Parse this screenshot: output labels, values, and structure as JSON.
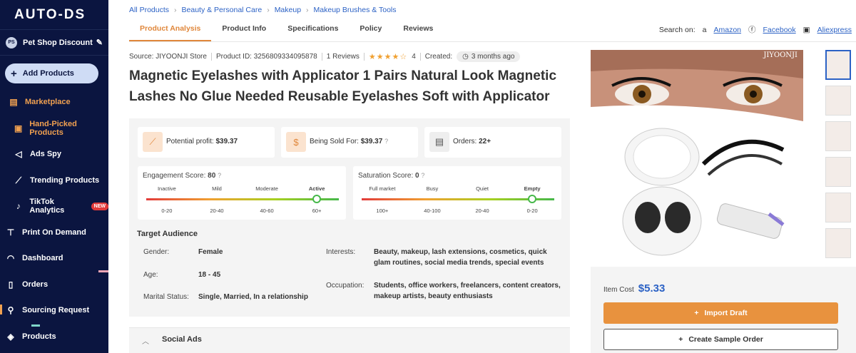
{
  "sidebar": {
    "logo": "AUTO-DS",
    "store_badge": "PS",
    "store_name": "Pet Shop Discount",
    "add_products": "Add Products",
    "items": [
      {
        "label": "Marketplace",
        "icon": "store-icon"
      },
      {
        "label": "Hand-Picked Products",
        "icon": "box-icon"
      },
      {
        "label": "Ads Spy",
        "icon": "megaphone-icon"
      },
      {
        "label": "Trending Products",
        "icon": "trend-icon"
      },
      {
        "label": "TikTok Analytics",
        "icon": "tiktok-icon",
        "badge": "NEW"
      },
      {
        "label": "Print On Demand",
        "icon": "shirt-icon"
      },
      {
        "label": "Dashboard",
        "icon": "gauge-icon"
      },
      {
        "label": "Orders",
        "icon": "clipboard-icon"
      },
      {
        "label": "Sourcing Request",
        "icon": "sourcing-icon"
      },
      {
        "label": "Products",
        "icon": "cube-icon"
      }
    ]
  },
  "breadcrumbs": [
    "All Products",
    "Beauty & Personal Care",
    "Makeup",
    "Makeup Brushes & Tools"
  ],
  "tabs": [
    "Product Analysis",
    "Product Info",
    "Specifications",
    "Policy",
    "Reviews"
  ],
  "search_on": {
    "label": "Search on:",
    "links": [
      "Amazon",
      "Facebook",
      "Aliexpress"
    ]
  },
  "meta": {
    "source": "Source: JIYOONJI Store",
    "product_id": "Product ID: 3256809334095878",
    "reviews": "1 Reviews",
    "rating": "4",
    "created_label": "Created:",
    "created_value": "3 months ago"
  },
  "title": "Magnetic Eyelashes with Applicator 1 Pairs Natural Look Magnetic Lashes No Glue Needed Reusable Eyelashes Soft with Applicator",
  "stats": {
    "profit_label": "Potential profit:",
    "profit_value": "$39.37",
    "sold_label": "Being Sold For:",
    "sold_value": "$39.37",
    "orders_label": "Orders:",
    "orders_value": "22+"
  },
  "engagement": {
    "label": "Engagement Score:",
    "value": "80",
    "levels": [
      "Inactive",
      "Mild",
      "Moderate",
      "Active"
    ],
    "ranges": [
      "0-20",
      "20-40",
      "40-60",
      "60+"
    ],
    "active_index": 3
  },
  "saturation": {
    "label": "Saturation Score:",
    "value": "0",
    "levels": [
      "Full market",
      "Busy",
      "Quiet",
      "Empty"
    ],
    "ranges": [
      "100+",
      "40-100",
      "20-40",
      "0-20"
    ],
    "active_index": 3
  },
  "audience": {
    "title": "Target Audience",
    "gender_label": "Gender:",
    "gender": "Female",
    "age_label": "Age:",
    "age": "18 - 45",
    "marital_label": "Marital Status:",
    "marital": "Single, Married, In a relationship",
    "interests_label": "Interests:",
    "interests": "Beauty, makeup, lash extensions, cosmetics, quick glam routines, social media trends, special events",
    "occupation_label": "Occupation:",
    "occupation": "Students, office workers, freelancers, content creators, makeup artists, beauty enthusiasts"
  },
  "social_ads": "Social Ads",
  "image_brand": "JIYOONJI",
  "item_cost_label": "Item Cost",
  "item_cost": "$5.33",
  "import_draft": "Import Draft",
  "create_sample": "Create Sample Order",
  "colors": {
    "sidebar": "#0b1540",
    "accent": "#e8923e",
    "link": "#2c62c5"
  }
}
